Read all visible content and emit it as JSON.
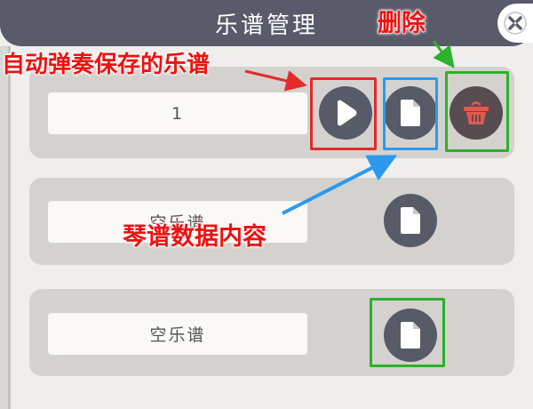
{
  "header": {
    "title": "乐谱管理"
  },
  "close_icon": "close-x-icon",
  "sheets": [
    {
      "name": "1",
      "actions": [
        "play-icon",
        "file-icon",
        "trash-icon"
      ]
    },
    {
      "name": "空乐谱",
      "actions": [
        "file-icon"
      ]
    },
    {
      "name": "空乐谱",
      "actions": [
        "file-icon"
      ]
    }
  ],
  "annotations": {
    "autoplay": "自动弹奏保存的乐谱",
    "delete": "删除",
    "content": "琴谱数据内容"
  },
  "colors": {
    "red": "#e32b2b",
    "blue": "#2a99ee",
    "green": "#2bb12b",
    "icon_bg": "#575a67",
    "trash_icon": "#e8574b"
  }
}
